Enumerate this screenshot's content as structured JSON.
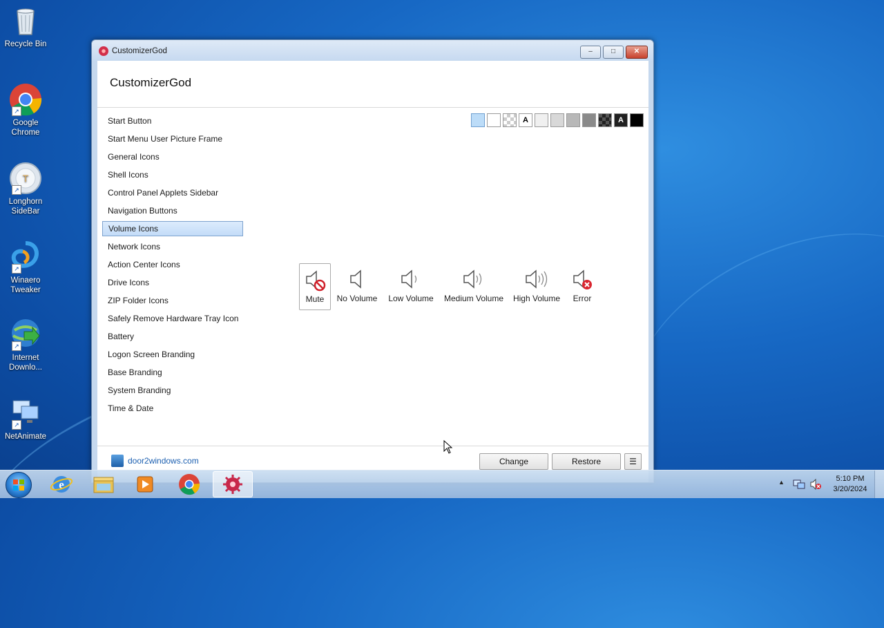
{
  "desktop": {
    "icons": [
      {
        "label": "Recycle Bin",
        "icon": "recycle-bin-icon"
      },
      {
        "label": "Google Chrome",
        "icon": "chrome-icon"
      },
      {
        "label": "Longhorn SideBar",
        "icon": "longhorn-sidebar-icon"
      },
      {
        "label": "Winaero Tweaker",
        "icon": "winaero-tweaker-icon"
      },
      {
        "label": "Internet Downlo...",
        "icon": "internet-download-manager-icon"
      },
      {
        "label": "NetAnimate",
        "icon": "netanimate-icon"
      }
    ]
  },
  "window": {
    "title": "CustomizerGod",
    "app_heading": "CustomizerGod",
    "minimize": "–",
    "maximize": "□",
    "close": "✕"
  },
  "sidebar": {
    "items": [
      {
        "label": "Start Button"
      },
      {
        "label": "Start Menu User Picture Frame"
      },
      {
        "label": "General Icons"
      },
      {
        "label": "Shell Icons"
      },
      {
        "label": "Control Panel Applets Sidebar"
      },
      {
        "label": "Navigation Buttons"
      },
      {
        "label": "Volume Icons",
        "selected": true
      },
      {
        "label": "Network Icons"
      },
      {
        "label": "Action Center Icons"
      },
      {
        "label": "Drive Icons"
      },
      {
        "label": "ZIP Folder Icons"
      },
      {
        "label": "Safely Remove Hardware Tray Icon"
      },
      {
        "label": "Battery"
      },
      {
        "label": "Logon Screen Branding"
      },
      {
        "label": "Base Branding"
      },
      {
        "label": "System Branding"
      },
      {
        "label": "Time & Date"
      }
    ]
  },
  "background_swatches": {
    "colors": [
      "#bcdcf8",
      "#ffffff",
      "checker",
      "#ffffff",
      "#f0f0f0",
      "#d8d8d8",
      "#b8b8b8",
      "#8a8a8a",
      "checker-dark",
      "#202020",
      "#000000"
    ],
    "labels": [
      "",
      "",
      "",
      "A",
      "",
      "",
      "",
      "",
      "",
      "A",
      ""
    ],
    "selected_index": 0
  },
  "volume_icons": [
    {
      "label": "Mute",
      "icon": "speaker-mute-icon",
      "selected": true
    },
    {
      "label": "No Volume",
      "icon": "speaker-no-volume-icon"
    },
    {
      "label": "Low Volume",
      "icon": "speaker-low-volume-icon"
    },
    {
      "label": "Medium Volume",
      "icon": "speaker-medium-volume-icon"
    },
    {
      "label": "High Volume",
      "icon": "speaker-high-volume-icon"
    },
    {
      "label": "Error",
      "icon": "speaker-error-icon"
    }
  ],
  "footer": {
    "link": "door2windows.com",
    "change_label": "Change",
    "restore_label": "Restore",
    "menu_label": "☰"
  },
  "taskbar": {
    "apps": [
      "internet-explorer-icon",
      "file-explorer-icon",
      "media-player-icon",
      "chrome-icon",
      "customizergod-icon"
    ],
    "active_app": "customizergod-icon",
    "tray": {
      "show_hidden": "▲",
      "time": "5:10 PM",
      "date": "3/20/2024"
    }
  }
}
